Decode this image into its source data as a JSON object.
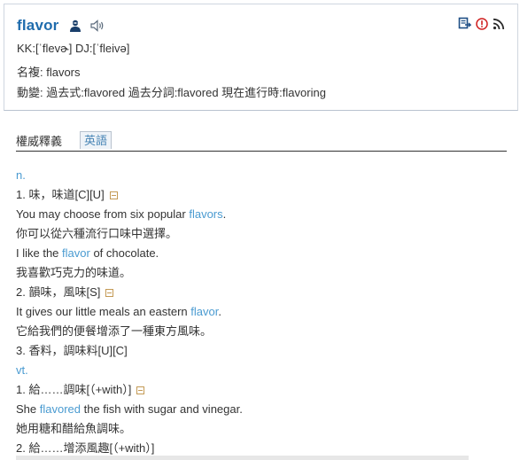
{
  "entry": {
    "word": "flavor",
    "pron": "KK:[ˈflevɚ] DJ:[ˈfleivə]",
    "plural": "名複: flavors",
    "verb_forms": "動變: 過去式:flavored  過去分詞:flavored  現在進行時:flavoring"
  },
  "icons": [
    "person-icon",
    "speaker-icon",
    "bookmark-icon",
    "alert-icon",
    "rss-icon"
  ],
  "tabs": {
    "authority_label": "權威釋義",
    "english_label": "英語"
  },
  "senses": [
    {
      "pos": "n."
    },
    {
      "def": "1. 味，味道[C][U]"
    },
    {
      "ex_pre": "You may choose from six popular ",
      "ex_hl": "flavors",
      "ex_post": "."
    },
    {
      "trans": "你可以從六種流行口味中選擇。"
    },
    {
      "ex_pre": "I like the ",
      "ex_hl": "flavor",
      "ex_post": " of chocolate."
    },
    {
      "trans": "我喜歡巧克力的味道。"
    },
    {
      "def": "2. 韻味，風味[S]"
    },
    {
      "ex_pre": "It gives our little meals an eastern ",
      "ex_hl": "flavor",
      "ex_post": "."
    },
    {
      "trans": "它給我們的便餐增添了一種東方風味。"
    },
    {
      "def": "3. 香料，調味料[U][C]"
    },
    {
      "pos": "vt."
    },
    {
      "def": "1. 給……調味[（+with）]"
    },
    {
      "ex_pre": "She ",
      "ex_hl": "flavored",
      "ex_post": " the fish with sugar and vinegar."
    },
    {
      "trans": "她用糖和醋給魚調味。"
    },
    {
      "def": "2. 給……增添風趣[（+with）]"
    }
  ],
  "colors": {
    "accent": "#1f6cad",
    "highlight": "#4a9bd1"
  }
}
